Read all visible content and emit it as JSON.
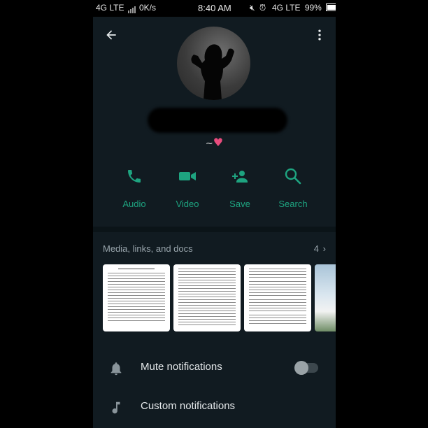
{
  "status_bar": {
    "left_network": "4G LTE",
    "data_speed": "0K/s",
    "time": "8:40 AM",
    "right_network": "4G LTE",
    "battery": "99%"
  },
  "contact": {
    "about": "~"
  },
  "actions": [
    {
      "label": "Audio",
      "icon": "phone-icon"
    },
    {
      "label": "Video",
      "icon": "video-camera-icon"
    },
    {
      "label": "Save",
      "icon": "add-person-icon"
    },
    {
      "label": "Search",
      "icon": "search-icon"
    }
  ],
  "media": {
    "title": "Media, links, and docs",
    "count": "4"
  },
  "settings": [
    {
      "label": "Mute notifications",
      "icon": "bell-icon",
      "toggle_on": false
    },
    {
      "label": "Custom notifications",
      "icon": "music-note-icon"
    }
  ],
  "colors": {
    "accent": "#1ea480",
    "background": "#0b1418",
    "surface": "#111b21",
    "heart": "#e84c7d"
  }
}
